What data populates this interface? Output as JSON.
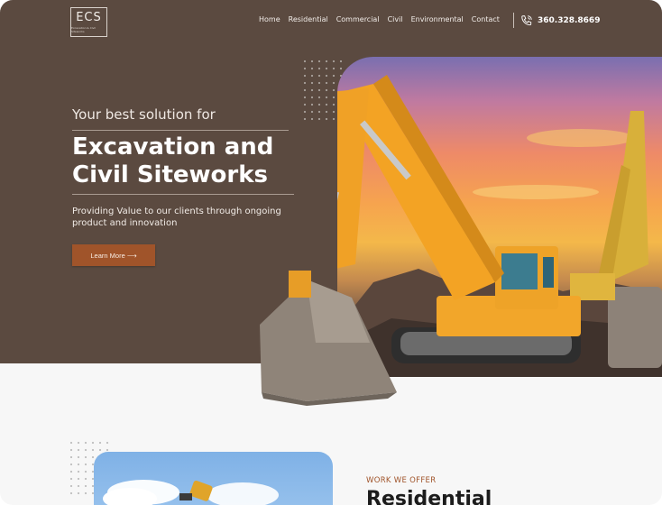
{
  "header": {
    "logo_text": "ECS",
    "logo_subtext": "Excavation & Civil Siteworks",
    "nav": [
      "Home",
      "Residential",
      "Commercial",
      "Civil",
      "Environmental",
      "Contact"
    ],
    "phone": "360.328.8669"
  },
  "hero": {
    "tagline": "Your best solution for",
    "headline_line1": "Excavation and",
    "headline_line2": "Civil Siteworks",
    "description": "Providing Value to our clients through ongoing product and innovation",
    "cta_label": "Learn More ⟶"
  },
  "section": {
    "eyebrow": "WORK WE OFFER",
    "title": "Residential"
  },
  "colors": {
    "hero_bg": "#5b4a40",
    "accent": "#a0542a",
    "section_bg": "#f7f7f7"
  },
  "icons": {
    "phone": "phone-icon"
  }
}
